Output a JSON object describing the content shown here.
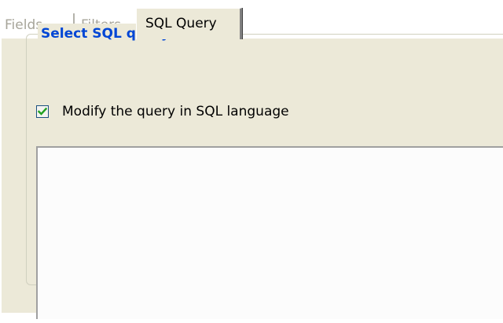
{
  "tabs": [
    {
      "label": "Fields",
      "state": "disabled"
    },
    {
      "label": "Filters",
      "state": "disabled"
    },
    {
      "label": "SQL Query",
      "state": "active"
    }
  ],
  "group": {
    "title": "Select SQL query",
    "checkbox": {
      "label": "Modify the query in SQL language",
      "checked": true
    },
    "sql_text": ""
  },
  "colors": {
    "panel_bg": "#ece9d8",
    "group_title": "#0046d5",
    "disabled_tab_text": "#a7a59a",
    "checkmark": "#21a121"
  },
  "icons": {
    "checkmark": "check-icon"
  }
}
